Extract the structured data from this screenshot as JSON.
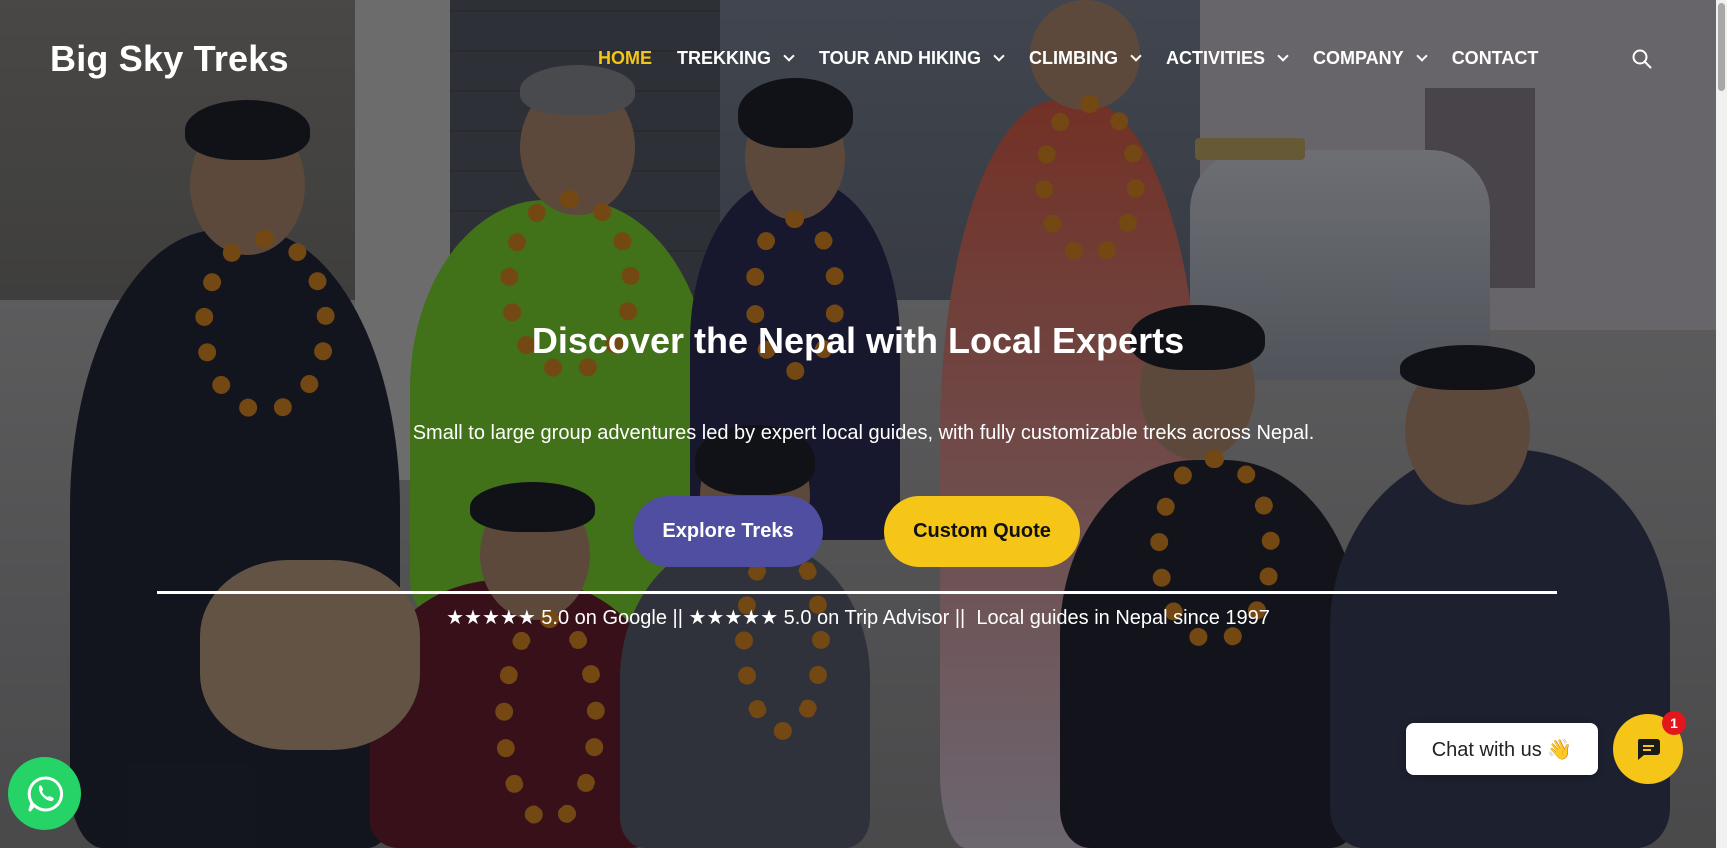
{
  "header": {
    "brand": "Big Sky Treks",
    "nav": [
      {
        "label": "HOME",
        "active": true,
        "dropdown": false
      },
      {
        "label": "TREKKING",
        "active": false,
        "dropdown": true
      },
      {
        "label": "TOUR AND HIKING",
        "active": false,
        "dropdown": true
      },
      {
        "label": "CLIMBING",
        "active": false,
        "dropdown": true
      },
      {
        "label": "ACTIVITIES",
        "active": false,
        "dropdown": true
      },
      {
        "label": "COMPANY",
        "active": false,
        "dropdown": true
      },
      {
        "label": "CONTACT",
        "active": false,
        "dropdown": false
      }
    ],
    "search_icon": "search-icon"
  },
  "hero": {
    "headline": "Discover the Nepal with Local Experts",
    "subline": "Small to large group adventures led by expert local guides, with fully customizable treks across Nepal.",
    "explore_label": "Explore Treks",
    "quote_label": "Custom Quote",
    "ratings": "★★★★★ 5.0 on Google || ★★★★★ 5.0 on Trip Advisor ||  Local guides in Nepal since 1997"
  },
  "widgets": {
    "whatsapp_icon": "whatsapp-icon",
    "chat_label": "Chat with us 👋",
    "chat_badge": "1"
  },
  "colors": {
    "accent_yellow": "#f5c518",
    "accent_purple": "#4f4ea0",
    "whatsapp_green": "#25d366",
    "badge_red": "#e3161e"
  }
}
